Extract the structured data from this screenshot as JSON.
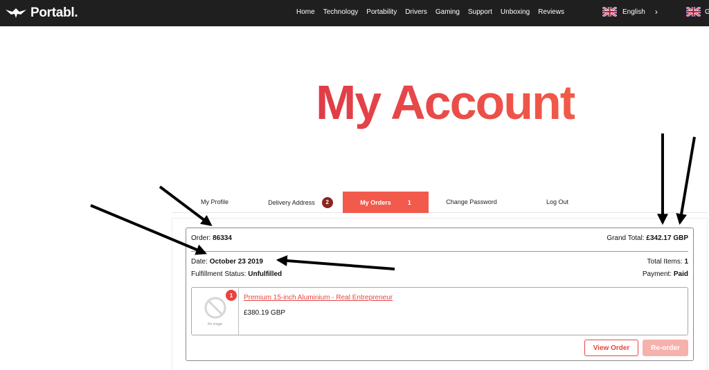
{
  "nav": {
    "brand": "Portabl.",
    "items": [
      "Home",
      "Technology",
      "Portability",
      "Drivers",
      "Gaming",
      "Support",
      "Unboxing",
      "Reviews"
    ],
    "language": "English",
    "language_chevron": "›",
    "language_partial": "G"
  },
  "page": {
    "title": "My Account"
  },
  "tabs": {
    "profile": "My Profile",
    "delivery": "Delivery Address",
    "delivery_badge": "2",
    "orders": "My Orders",
    "orders_badge": "1",
    "password": "Change Password",
    "logout": "Log Out"
  },
  "order": {
    "number_label": "Order:",
    "number": "86334",
    "grand_total_label": "Grand Total:",
    "grand_total": "£342.17 GBP",
    "date_label": "Date:",
    "date": "October 23 2019",
    "total_items_label": "Total Items:",
    "total_items": "1",
    "fulfillment_label": "Fulfillment Status:",
    "fulfillment": "Unfulfilled",
    "payment_label": "Payment:",
    "payment": "Paid",
    "item": {
      "quantity": "1",
      "no_image_label": "No image",
      "name": "Premium 15-inch Aluminium - Real Entrepreneur",
      "price": "£380.19 GBP"
    },
    "view_button": "View Order",
    "reorder_button": "Re-order"
  },
  "colors": {
    "accent": "#f25a4c",
    "title_gradient_start": "#e03c48",
    "title_gradient_end": "#f25a48",
    "topbar": "#1f1f1f",
    "badge_dark": "#8a2620"
  }
}
